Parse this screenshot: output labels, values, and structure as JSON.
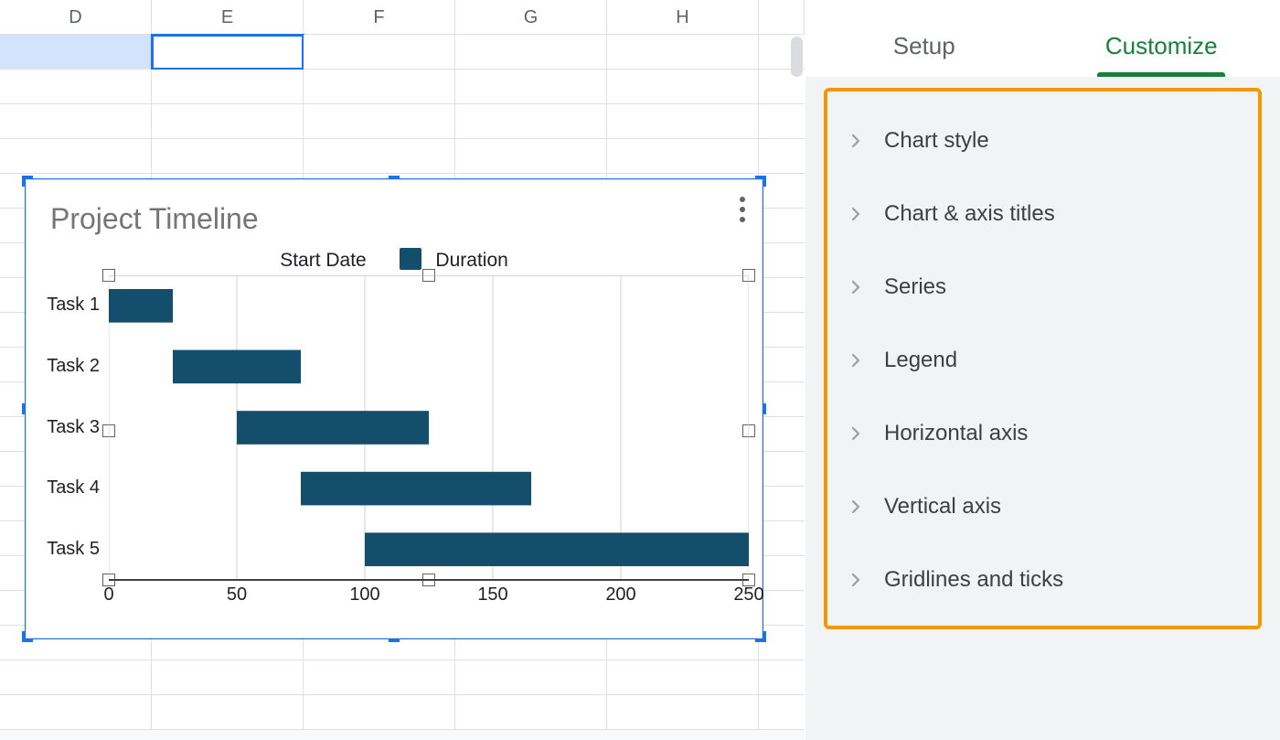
{
  "sheet": {
    "columns": [
      "D",
      "E",
      "F",
      "G",
      "H"
    ],
    "selected_cell": "E3"
  },
  "chart": {
    "title": "Project Timeline",
    "legend": {
      "series1": "Start Date",
      "series2": "Duration"
    },
    "menu_tooltip": "More"
  },
  "panel": {
    "tabs": {
      "setup": "Setup",
      "customize": "Customize"
    },
    "active_tab": "Customize",
    "customize_sections": [
      "Chart style",
      "Chart & axis titles",
      "Series",
      "Legend",
      "Horizontal axis",
      "Vertical axis",
      "Gridlines and ticks"
    ]
  },
  "chart_data": {
    "type": "bar",
    "orientation": "horizontal",
    "stacked": true,
    "title": "Project Timeline",
    "xlabel": "",
    "ylabel": "",
    "xlim": [
      0,
      250
    ],
    "xticks": [
      0,
      50,
      100,
      150,
      200,
      250
    ],
    "categories": [
      "Task 1",
      "Task 2",
      "Task 3",
      "Task 4",
      "Task 5"
    ],
    "series": [
      {
        "name": "Start Date",
        "values": [
          0,
          25,
          50,
          75,
          100
        ],
        "color": "transparent"
      },
      {
        "name": "Duration",
        "values": [
          25,
          50,
          75,
          90,
          150
        ],
        "color": "#134f6c"
      }
    ],
    "legend_position": "top",
    "grid": true
  }
}
